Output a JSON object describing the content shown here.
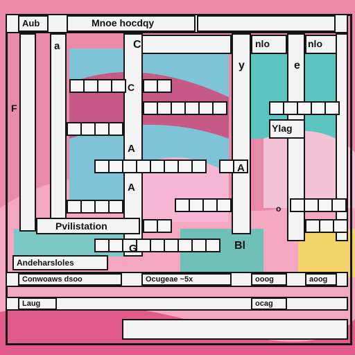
{
  "header": {
    "left_tab": "Aub",
    "title": "Mnoe hocdqy"
  },
  "grid_labels": {
    "a": "a",
    "c": "C",
    "y": "y",
    "e": "e",
    "c2": "C",
    "f": "F",
    "a2": "A",
    "a3": "A",
    "a4": "A",
    "b": "Bl",
    "o": "o",
    "g": "G"
  },
  "top_right_words": {
    "w1": "nlo",
    "w2": "nlo"
  },
  "side_word": "Ylag",
  "row_word": "Pvilistation",
  "clues": {
    "heading": "Andeharsloles",
    "row1_left": "Conwoaws dsoo",
    "row1_mid": "Ocugeae ~5x",
    "row1_r1": "ooog",
    "row1_r2": "aoog",
    "row2_left": "Laug",
    "row2_right": "ocag"
  },
  "colors": {
    "background": "#e98aa8",
    "cell": "#f6f6f6",
    "border": "#151515"
  }
}
